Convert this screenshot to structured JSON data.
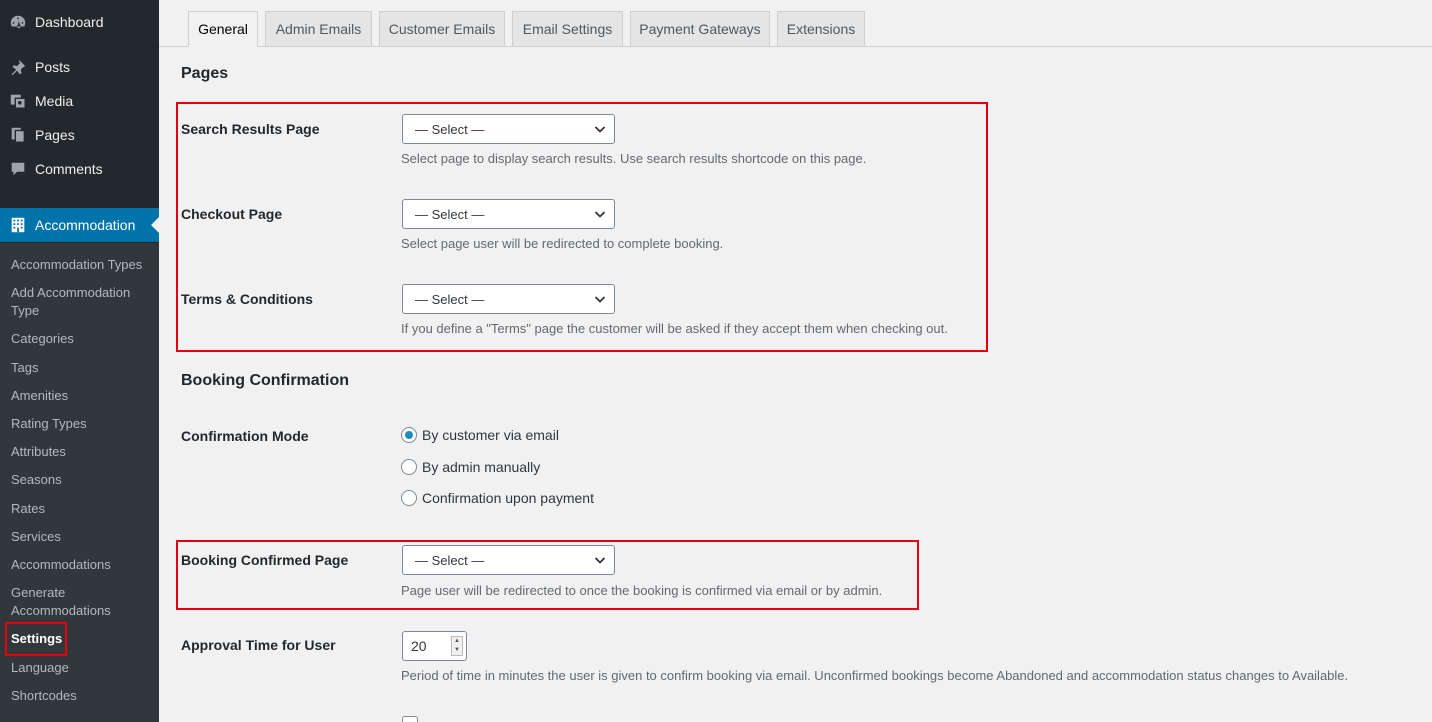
{
  "sidebar": {
    "top_items": [
      {
        "label": "Dashboard",
        "icon": "dashboard-icon"
      },
      {
        "label": "Posts",
        "icon": "pin-icon"
      },
      {
        "label": "Media",
        "icon": "media-icon"
      },
      {
        "label": "Pages",
        "icon": "pages-icon"
      },
      {
        "label": "Comments",
        "icon": "comment-icon"
      },
      {
        "label": "Accommodation",
        "icon": "building-icon"
      }
    ],
    "sub_items": [
      "Accommodation Types",
      "Add Accommodation Type",
      "Categories",
      "Tags",
      "Amenities",
      "Rating Types",
      "Attributes",
      "Seasons",
      "Rates",
      "Services",
      "Accommodations",
      "Generate Accommodations",
      "Settings",
      "Language",
      "Shortcodes"
    ]
  },
  "tabs": [
    "General",
    "Admin Emails",
    "Customer Emails",
    "Email Settings",
    "Payment Gateways",
    "Extensions"
  ],
  "pages_section": {
    "title": "Pages",
    "fields": [
      {
        "label": "Search Results Page",
        "value": "— Select —",
        "description": "Select page to display search results. Use search results shortcode on this page."
      },
      {
        "label": "Checkout Page",
        "value": "— Select —",
        "description": "Select page user will be redirected to complete booking."
      },
      {
        "label": "Terms & Conditions",
        "value": "— Select —",
        "description": "If you define a \"Terms\" page the customer will be asked if they accept them when checking out."
      }
    ]
  },
  "booking_section": {
    "title": "Booking Confirmation",
    "confirmation_mode": {
      "label": "Confirmation Mode",
      "options": [
        "By customer via email",
        "By admin manually",
        "Confirmation upon payment"
      ],
      "selected": "By customer via email"
    },
    "confirmed_page": {
      "label": "Booking Confirmed Page",
      "value": "— Select —",
      "description": "Page user will be redirected to once the booking is confirmed via email or by admin."
    },
    "approval_time": {
      "label": "Approval Time for User",
      "value": "20",
      "description": "Period of time in minutes the user is given to confirm booking via email. Unconfirmed bookings become Abandoned and accommodation status changes to Available."
    }
  },
  "colors": {
    "accent": "#0073aa",
    "highlight": "#e4000f",
    "sidebar_bg": "#23282d",
    "submenu_bg": "#32373c"
  }
}
